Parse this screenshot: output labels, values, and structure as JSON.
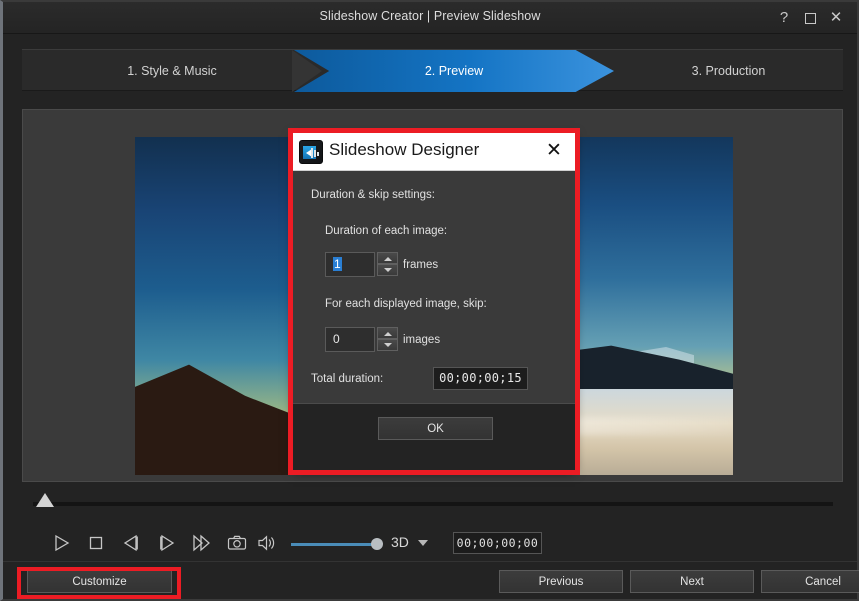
{
  "window": {
    "title": "Slideshow Creator | Preview Slideshow",
    "controls": {
      "help": "?",
      "maximize": "maximize-icon",
      "close": "✕"
    }
  },
  "steps": [
    {
      "label": "1. Style & Music",
      "active": false
    },
    {
      "label": "2. Preview",
      "active": true
    },
    {
      "label": "3. Production",
      "active": false
    }
  ],
  "preview": {
    "left_image_alt": "mountain ridge at dusk",
    "right_image_alt": "mountain above sea of clouds"
  },
  "transport": {
    "play": "play-icon",
    "stop": "stop-icon",
    "previous_frame": "previous-frame-icon",
    "next_frame": "next-frame-icon",
    "fast_forward": "fast-forward-icon",
    "snapshot": "camera-icon",
    "volume": "volume-icon",
    "mode_label": "3D",
    "mode_dropdown": "chevron-down-icon",
    "timecode": "00;00;00;00",
    "volume_level_pct": 100,
    "timeline_position_pct": 0
  },
  "bottom_bar": {
    "customize": "Customize",
    "previous": "Previous",
    "next": "Next",
    "cancel": "Cancel"
  },
  "dialog": {
    "title": "Slideshow Designer",
    "close": "✕",
    "app_icon": "slideshow-designer-icon",
    "section_label": "Duration & skip settings:",
    "duration_label": "Duration of each image:",
    "duration_value": "1",
    "duration_unit": "frames",
    "skip_label": "For each displayed image, skip:",
    "skip_value": "0",
    "skip_unit": "images",
    "total_label": "Total duration:",
    "total_value": "00;00;00;15",
    "ok": "OK"
  },
  "colors": {
    "accent_blue": "#1474c4",
    "highlight_red": "#ec1c24",
    "panel_bg": "#3a3a3a",
    "window_bg": "#232323",
    "selection_blue": "#2a7fd4"
  }
}
